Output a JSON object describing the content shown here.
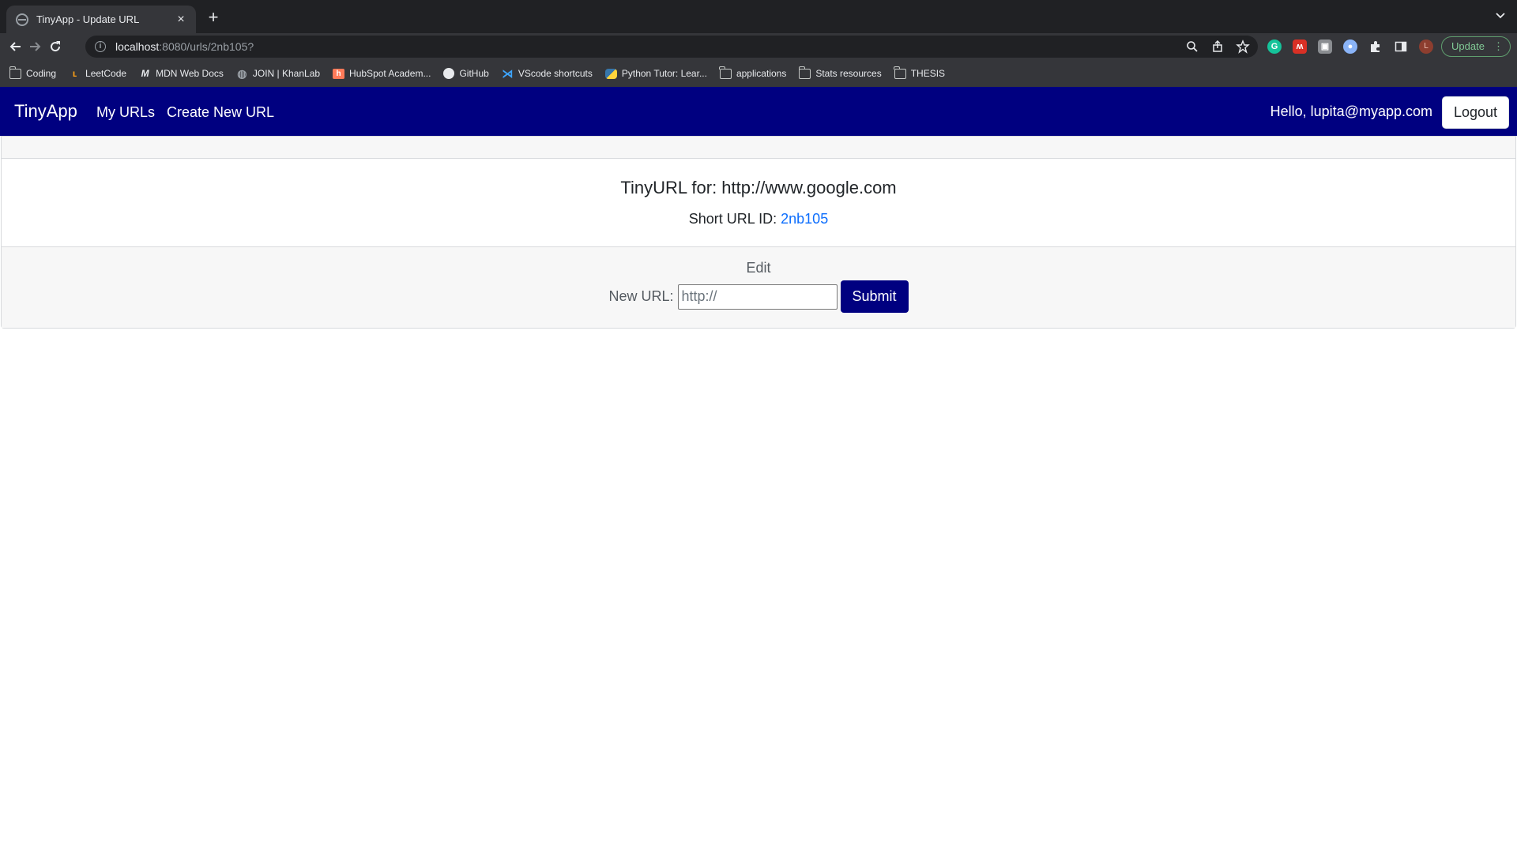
{
  "browser": {
    "tab_title": "TinyApp - Update URL",
    "tab_close": "×",
    "new_tab": "+",
    "url_host": "localhost",
    "url_path": ":8080/urls/2nb105?",
    "update_label": "Update",
    "avatar_letter": "L",
    "bookmarks": [
      {
        "label": "Coding",
        "icon": "folder-icon"
      },
      {
        "label": "LeetCode",
        "icon": "leetcode-icon"
      },
      {
        "label": "MDN Web Docs",
        "icon": "mdn-icon"
      },
      {
        "label": "JOIN | KhanLab",
        "icon": "globe-icon"
      },
      {
        "label": "HubSpot Academ...",
        "icon": "hubspot-icon"
      },
      {
        "label": "GitHub",
        "icon": "github-icon"
      },
      {
        "label": "VScode shortcuts",
        "icon": "vscode-icon"
      },
      {
        "label": "Python Tutor: Lear...",
        "icon": "python-icon"
      },
      {
        "label": "applications",
        "icon": "folder-icon"
      },
      {
        "label": "Stats resources",
        "icon": "folder-icon"
      },
      {
        "label": "THESIS",
        "icon": "folder-icon"
      }
    ]
  },
  "navbar": {
    "brand": "TinyApp",
    "my_urls": "My URLs",
    "create_new_url": "Create New URL",
    "greeting": "Hello, lupita@myapp.com",
    "logout": "Logout"
  },
  "card": {
    "title": "TinyURL for: http://www.google.com",
    "short_url_label": "Short URL ID: ",
    "short_url_id": "2nb105",
    "edit_label": "Edit",
    "new_url_label": "New URL:",
    "new_url_placeholder": "http://",
    "new_url_value": "",
    "submit": "Submit"
  },
  "colors": {
    "navbar_bg": "#000080",
    "link": "#0d6efd",
    "submit_bg": "#000080"
  }
}
